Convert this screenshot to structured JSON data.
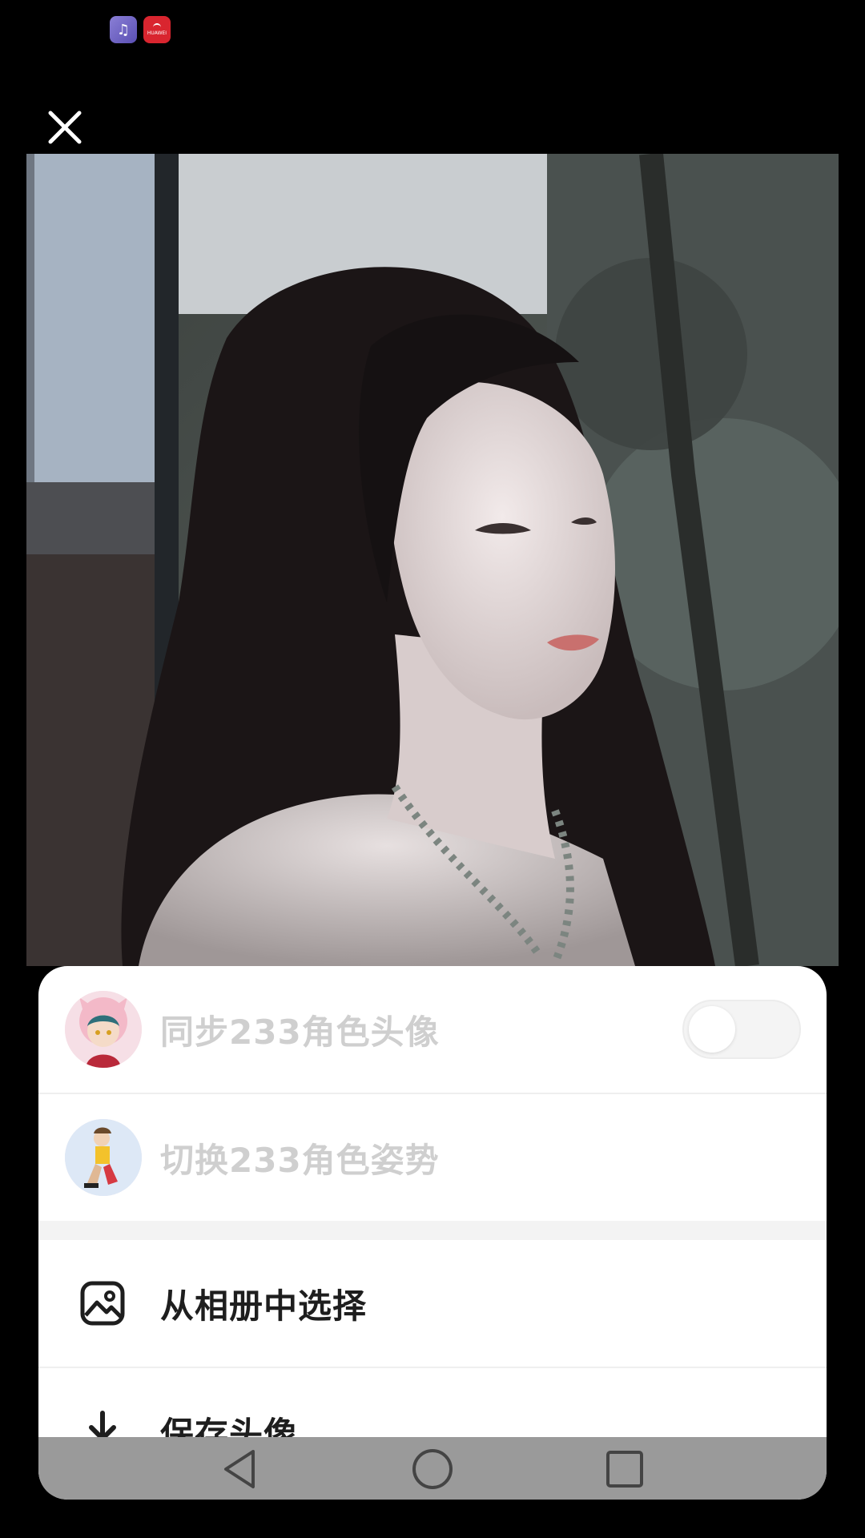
{
  "status_bar": {
    "icons": [
      "music-app-icon",
      "huawei-app-icon"
    ],
    "huawei_badge": "HUAWEI"
  },
  "viewer": {
    "close_icon": "close-icon",
    "photo_description": "profile-photo"
  },
  "sheet": {
    "sync_row": {
      "label": "同步233角色头像",
      "toggle_on": false,
      "enabled": false
    },
    "switch_row": {
      "label": "切换233角色姿势",
      "enabled": false
    },
    "album_row": {
      "label": "从相册中选择",
      "icon": "image-icon"
    },
    "save_row": {
      "label": "保存头像",
      "icon": "download-icon"
    }
  },
  "nav_bar": {
    "buttons": [
      "back-triangle-icon",
      "home-circle-icon",
      "recents-square-icon"
    ]
  },
  "colors": {
    "background": "#000000",
    "sheet": "#ffffff",
    "disabled_text": "#cfcfcf",
    "primary_text": "#1e1e1e",
    "nav_bar": "#9a9a9a"
  }
}
